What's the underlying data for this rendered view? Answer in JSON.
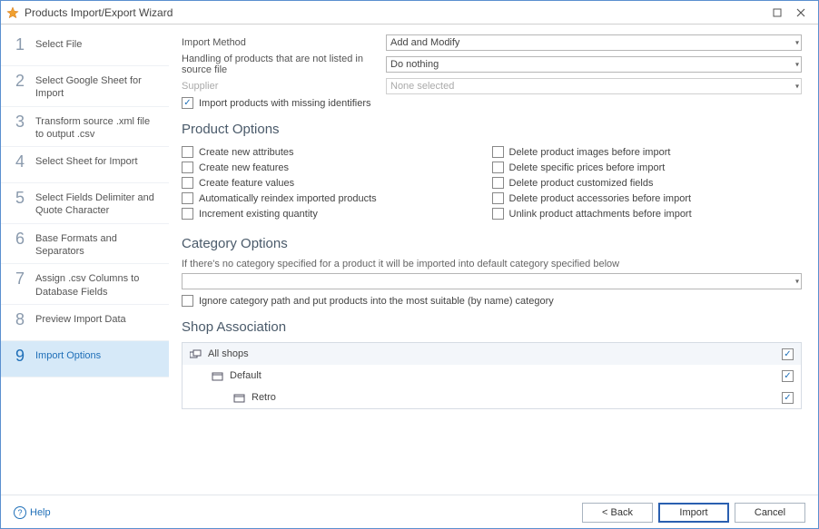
{
  "window": {
    "title": "Products Import/Export Wizard"
  },
  "steps": [
    {
      "num": "1",
      "label": "Select File"
    },
    {
      "num": "2",
      "label": "Select Google Sheet for Import"
    },
    {
      "num": "3",
      "label": "Transform source .xml file to output .csv"
    },
    {
      "num": "4",
      "label": "Select Sheet for Import"
    },
    {
      "num": "5",
      "label": "Select Fields Delimiter and Quote Character"
    },
    {
      "num": "6",
      "label": "Base Formats and Separators"
    },
    {
      "num": "7",
      "label": "Assign .csv Columns to Database Fields"
    },
    {
      "num": "8",
      "label": "Preview Import Data"
    },
    {
      "num": "9",
      "label": "Import Options"
    }
  ],
  "form": {
    "import_method_label": "Import Method",
    "import_method_value": "Add and Modify",
    "handling_label": "Handling of products that are not listed in source file",
    "handling_value": "Do nothing",
    "supplier_label": "Supplier",
    "supplier_value": "None selected",
    "missing_ids_label": "Import products with missing identifiers"
  },
  "product_options": {
    "heading": "Product Options",
    "left": [
      "Create new attributes",
      "Create new features",
      "Create feature values",
      "Automatically reindex imported products",
      "Increment existing quantity"
    ],
    "right": [
      "Delete product images before import",
      "Delete specific prices before import",
      "Delete product customized fields",
      "Delete product accessories before import",
      "Unlink product attachments before import"
    ]
  },
  "category_options": {
    "heading": "Category Options",
    "note": "If there's no category specified for a product it will be imported into default category specified below",
    "ignore_label": "Ignore category path and put products into the most suitable (by name) category"
  },
  "shop": {
    "heading": "Shop Association",
    "all": "All shops",
    "default": "Default",
    "retro": "Retro"
  },
  "footer": {
    "help": "Help",
    "back": "< Back",
    "import": "Import",
    "cancel": "Cancel"
  }
}
